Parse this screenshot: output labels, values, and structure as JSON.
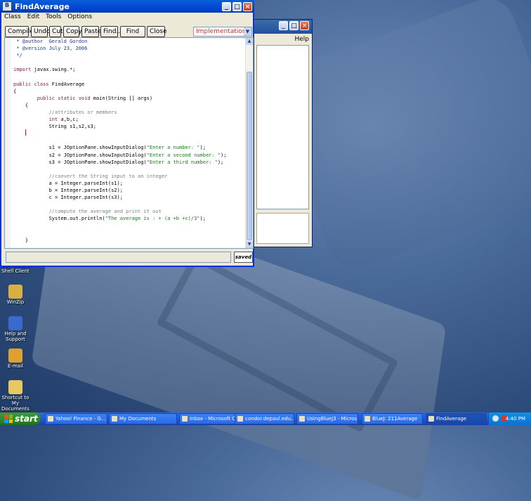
{
  "editor_window": {
    "title": "FindAverage",
    "menu": [
      "Class",
      "Edit",
      "Tools",
      "Options"
    ],
    "toolbar": [
      "Compile",
      "Undo",
      "Cut",
      "Copy",
      "Paste",
      "Find...",
      "Find Next",
      "Close"
    ],
    "view_select": "Implementation",
    "code_lines": [
      [
        [
          "doc",
          " * @author  Gerald Gordon"
        ]
      ],
      [
        [
          "doc",
          " * @version July 23, 2006"
        ]
      ],
      [
        [
          "doc",
          " */"
        ]
      ],
      [
        [
          "plain",
          ""
        ]
      ],
      [
        [
          "kw",
          "import"
        ],
        [
          "plain",
          " javax.swing.*;"
        ]
      ],
      [
        [
          "plain",
          ""
        ]
      ],
      [
        [
          "kw",
          "public class"
        ],
        [
          "plain",
          " FindAverage"
        ]
      ],
      [
        [
          "plain",
          "{"
        ]
      ],
      [
        [
          "plain",
          "        "
        ],
        [
          "kw",
          "public static void"
        ],
        [
          "plain",
          " main(String [] args)"
        ]
      ],
      [
        [
          "plain",
          "    {"
        ]
      ],
      [
        [
          "plain",
          "            "
        ],
        [
          "comment",
          "//attributes or members"
        ]
      ],
      [
        [
          "plain",
          "            "
        ],
        [
          "kw",
          "int"
        ],
        [
          "plain",
          " a,b,c;"
        ]
      ],
      [
        [
          "plain",
          "            String s1,s2,s3;"
        ]
      ],
      [
        [
          "plain",
          ""
        ]
      ],
      [
        [
          "plain",
          ""
        ]
      ],
      [
        [
          "plain",
          "            s1 = JOptionPane.showInputDialog("
        ],
        [
          "str",
          "\"Enter a number: \""
        ],
        [
          "plain",
          ");"
        ]
      ],
      [
        [
          "plain",
          "            s2 = JOptionPane.showInputDialog("
        ],
        [
          "str",
          "\"Enter a second number: \""
        ],
        [
          "plain",
          ");"
        ]
      ],
      [
        [
          "plain",
          "            s3 = JOptionPane.showInputDialog("
        ],
        [
          "str",
          "\"Enter a third number: \""
        ],
        [
          "plain",
          ");"
        ]
      ],
      [
        [
          "plain",
          ""
        ]
      ],
      [
        [
          "plain",
          "            "
        ],
        [
          "comment",
          "//convert the String input to an integer"
        ]
      ],
      [
        [
          "plain",
          "            a = Integer.parseInt(s1);"
        ]
      ],
      [
        [
          "plain",
          "            b = Integer.parseInt(s2);"
        ]
      ],
      [
        [
          "plain",
          "            c = Integer.parseInt(s3);"
        ]
      ],
      [
        [
          "plain",
          ""
        ]
      ],
      [
        [
          "plain",
          "            "
        ],
        [
          "comment",
          "//compute the average and print it out"
        ]
      ],
      [
        [
          "plain",
          "            System.out.println("
        ],
        [
          "str",
          "\"The average is : + (a +b +c)/3\""
        ],
        [
          "plain",
          ");"
        ]
      ],
      [
        [
          "plain",
          ""
        ]
      ],
      [
        [
          "plain",
          ""
        ]
      ],
      [
        [
          "plain",
          "    }"
        ]
      ],
      [
        [
          "plain",
          ""
        ]
      ],
      [
        [
          "plain",
          "}"
        ]
      ]
    ],
    "status_message": "",
    "saved_label": "saved"
  },
  "back_window": {
    "help_menu": "Help"
  },
  "desktop_icons": [
    {
      "label": "SSH Secure Shell Client",
      "icon": "ssh-icon",
      "color": "#6a7a9a"
    },
    {
      "label": "WinZip",
      "icon": "winzip-icon",
      "color": "#d8b040"
    },
    {
      "label": "Help and Support",
      "icon": "help-icon",
      "color": "#3a6ad0"
    },
    {
      "label": "E-mail",
      "icon": "email-icon",
      "color": "#e0a030"
    },
    {
      "label": "Shortcut to My Documents",
      "icon": "folder-icon",
      "color": "#e8c860"
    }
  ],
  "taskbar": {
    "start_label": "start",
    "items": [
      {
        "label": "Yahoo! Finance - G...",
        "active": false
      },
      {
        "label": "My Documents",
        "active": false
      },
      {
        "label": "Inbox - Microsoft O...",
        "active": false
      },
      {
        "label": "condor.depaul.edu...",
        "active": false
      },
      {
        "label": "UsingBlueJ3 - Micros...",
        "active": false
      },
      {
        "label": "BlueJ: 211Average",
        "active": false
      },
      {
        "label": "FindAverage",
        "active": true
      }
    ],
    "clock": "4:40 PM"
  },
  "colors": {
    "accent_title": "#0046d5",
    "start_green": "#2f8a2f",
    "keyword": "#7a2050",
    "string": "#1a7a1a",
    "comment": "#808080"
  }
}
